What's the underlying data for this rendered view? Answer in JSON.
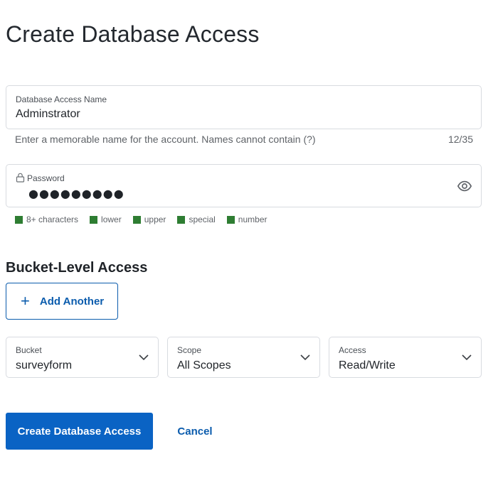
{
  "page": {
    "title": "Create Database Access"
  },
  "name_field": {
    "label": "Database Access Name",
    "value": "Adminstrator",
    "helper": "Enter a memorable name for the account. Names cannot contain (?)",
    "char_count": "12/35"
  },
  "password_field": {
    "label": "Password",
    "masked_value": "●●●●●●●●●",
    "lock_icon": "lock-icon",
    "visibility_icon": "eye-icon",
    "rules": [
      {
        "label": "8+ characters",
        "met": true
      },
      {
        "label": "lower",
        "met": true
      },
      {
        "label": "upper",
        "met": true
      },
      {
        "label": "special",
        "met": true
      },
      {
        "label": "number",
        "met": true
      }
    ],
    "rule_met_color": "#2e7d32"
  },
  "bucket_access": {
    "heading": "Bucket-Level Access",
    "add_label": "Add Another",
    "bucket": {
      "label": "Bucket",
      "value": "surveyform"
    },
    "scope": {
      "label": "Scope",
      "value": "All Scopes"
    },
    "access": {
      "label": "Access",
      "value": "Read/Write"
    }
  },
  "actions": {
    "submit_label": "Create Database Access",
    "cancel_label": "Cancel"
  },
  "colors": {
    "accent": "#0a63c4",
    "link": "#0b5cad"
  }
}
